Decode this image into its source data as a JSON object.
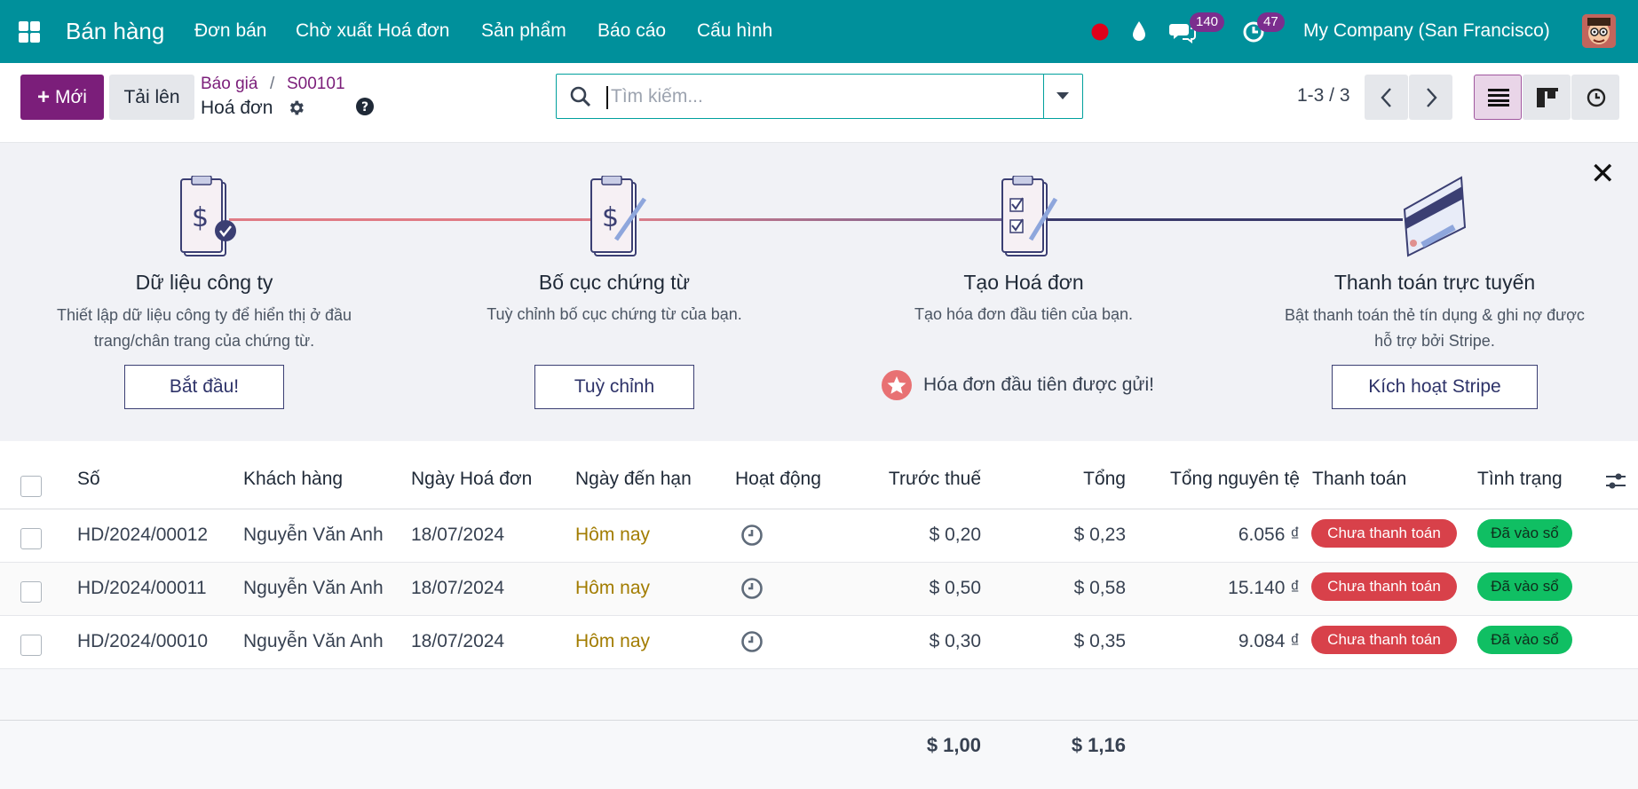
{
  "topbar": {
    "app_title": "Bán hàng",
    "menu": [
      "Đơn bán",
      "Chờ xuất Hoá đơn",
      "Sản phẩm",
      "Báo cáo",
      "Cấu hình"
    ],
    "messages_count": "140",
    "activities_count": "47",
    "company": "My Company (San Francisco)"
  },
  "control": {
    "new_label": "Mới",
    "upload_label": "Tải lên",
    "breadcrumb": [
      "Báo giá",
      "S00101"
    ],
    "breadcrumb_sep": "/",
    "current_title": "Hoá đơn",
    "search_placeholder": "Tìm kiếm...",
    "pager": "1-3 / 3"
  },
  "onboarding": {
    "steps": [
      {
        "title": "Dữ liệu công ty",
        "desc_lines": [
          "Thiết lập dữ liệu công ty để hiển thị ở đầu",
          "trang/chân trang của chứng từ."
        ],
        "button": "Bắt đầu!"
      },
      {
        "title": "Bố cục chứng từ",
        "desc_lines": [
          "Tuỳ chỉnh bố cục chứng từ của bạn."
        ],
        "button": "Tuỳ chỉnh"
      },
      {
        "title": "Tạo Hoá đơn",
        "desc_lines": [
          "Tạo hóa đơn đầu tiên của bạn."
        ],
        "done": "Hóa đơn đầu tiên được gửi!"
      },
      {
        "title": "Thanh toán trực tuyến",
        "desc_lines": [
          "Bật thanh toán thẻ tín dụng & ghi nợ được",
          "hỗ trợ bởi Stripe."
        ],
        "button": "Kích hoạt Stripe"
      }
    ]
  },
  "table": {
    "headers": [
      "Số",
      "Khách hàng",
      "Ngày Hoá đơn",
      "Ngày đến hạn",
      "Hoạt động",
      "Trước thuế",
      "Tổng",
      "Tổng nguyên tệ",
      "Thanh toán",
      "Tình trạng"
    ],
    "rows": [
      {
        "number": "HD/2024/00012",
        "customer": "Nguyễn Văn Anh",
        "date": "18/07/2024",
        "due": "Hôm nay",
        "untaxed": "$ 0,20",
        "total": "$ 0,23",
        "total_currency": "6.056 ₫",
        "payment": "Chưa thanh toán",
        "state": "Đã vào sổ"
      },
      {
        "number": "HD/2024/00011",
        "customer": "Nguyễn Văn Anh",
        "date": "18/07/2024",
        "due": "Hôm nay",
        "untaxed": "$ 0,50",
        "total": "$ 0,58",
        "total_currency": "15.140 ₫",
        "payment": "Chưa thanh toán",
        "state": "Đã vào sổ"
      },
      {
        "number": "HD/2024/00010",
        "customer": "Nguyễn Văn Anh",
        "date": "18/07/2024",
        "due": "Hôm nay",
        "untaxed": "$ 0,30",
        "total": "$ 0,35",
        "total_currency": "9.084 ₫",
        "payment": "Chưa thanh toán",
        "state": "Đã vào sổ"
      }
    ],
    "totals": {
      "untaxed": "$ 1,00",
      "total": "$ 1,16"
    }
  },
  "colors": {
    "topbar": "#00909b",
    "primary": "#7b1e7a",
    "unpaid": "#d8414a",
    "posted": "#10bf63",
    "due_today": "#a27c00"
  }
}
